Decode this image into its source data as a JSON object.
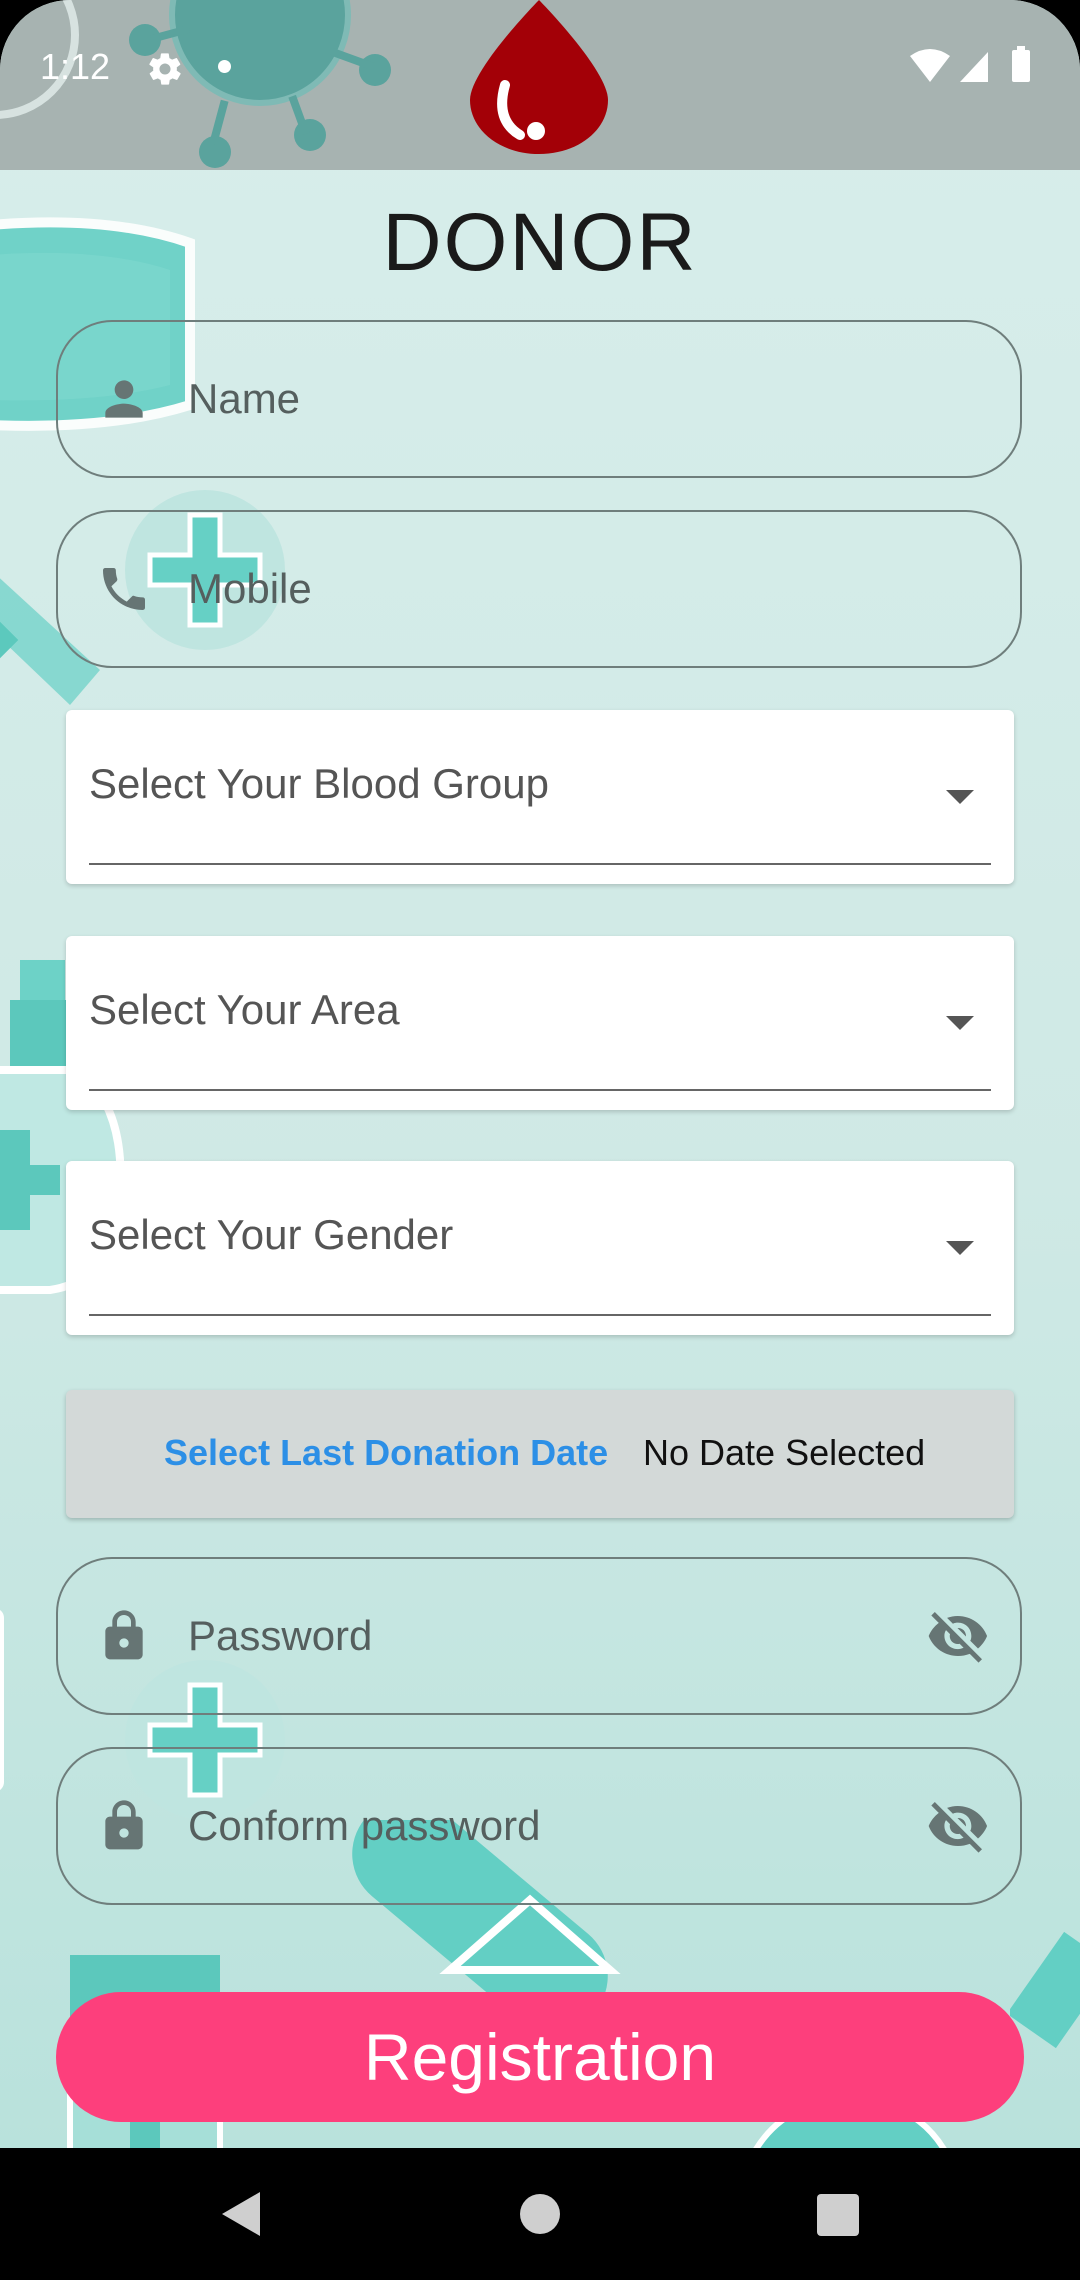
{
  "status_bar": {
    "time": "1:12",
    "icons": [
      "settings-icon",
      "notification-dot",
      "wifi-icon",
      "signal-icon",
      "battery-icon"
    ]
  },
  "header": {
    "title": "DONOR"
  },
  "form": {
    "name": {
      "placeholder": "Name",
      "icon": "person-icon"
    },
    "mobile": {
      "placeholder": "Mobile",
      "icon": "phone-icon"
    },
    "blood_group": {
      "label": "Select Your Blood Group"
    },
    "area": {
      "label": "Select Your Area"
    },
    "gender": {
      "label": "Select Your Gender"
    },
    "last_donation": {
      "link": "Select Last Donation Date",
      "value": "No Date Selected"
    },
    "password": {
      "placeholder": "Password",
      "icon": "lock-icon",
      "toggle_icon": "visibility-off-icon"
    },
    "confirm_password": {
      "placeholder": "Conform password",
      "icon": "lock-icon",
      "toggle_icon": "visibility-off-icon"
    },
    "submit_label": "Registration"
  },
  "nav_bar": {
    "buttons": [
      "back-icon",
      "home-icon",
      "recents-icon"
    ]
  },
  "colors": {
    "background": "#d8eeeb",
    "accent_teal": "#63cfc4",
    "status_bar": "#a7b3b1",
    "button": "#fd3f7c",
    "link": "#2c8fe6",
    "drop": "#a30007"
  }
}
